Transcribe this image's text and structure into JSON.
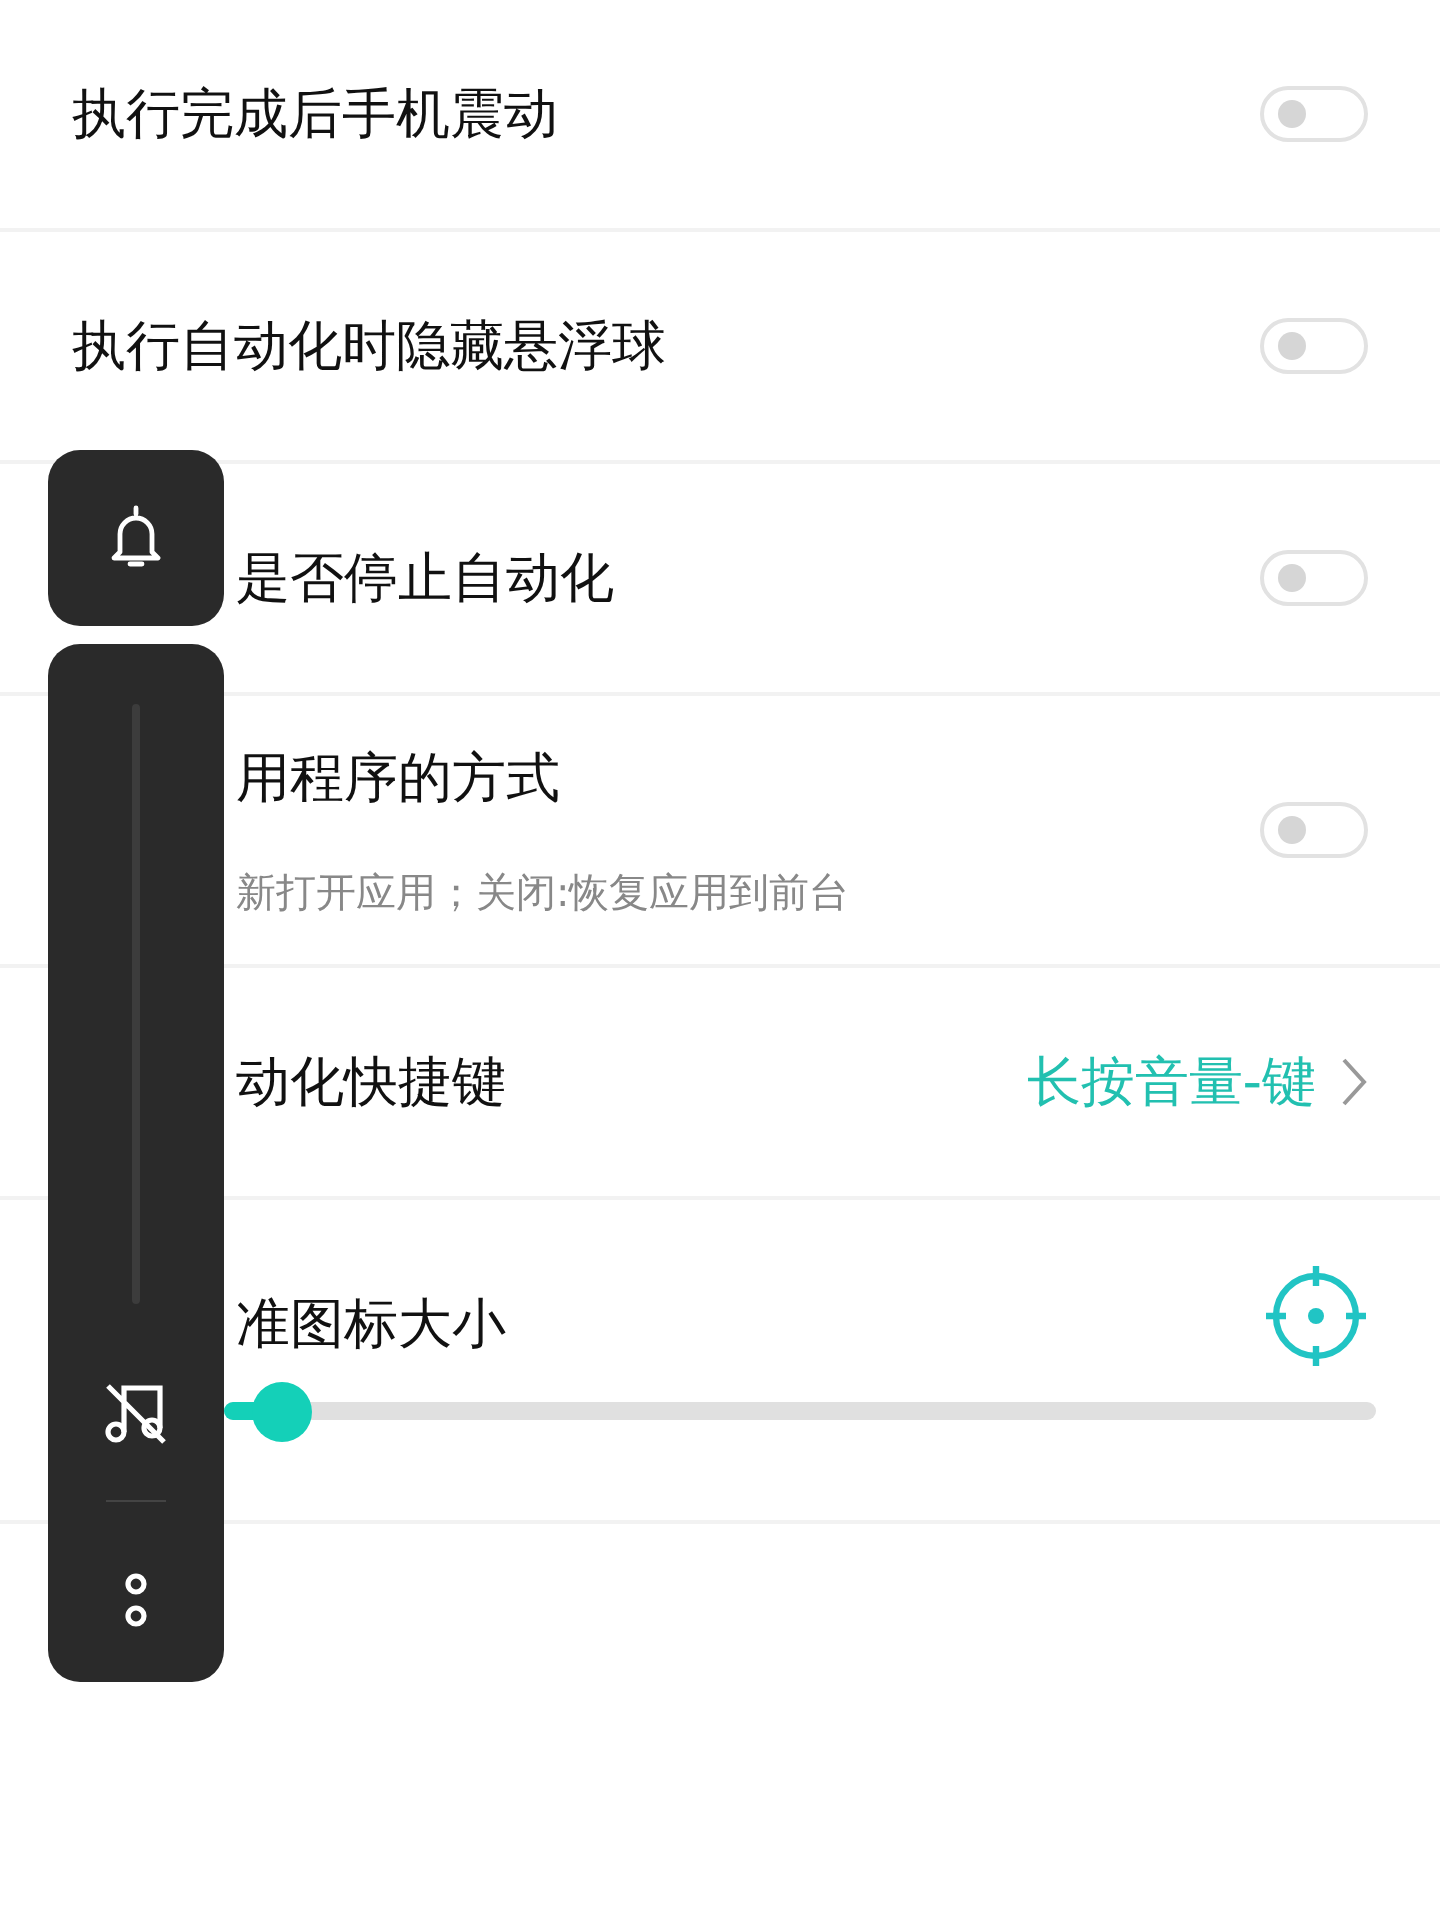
{
  "settings": [
    {
      "kind": "toggle",
      "label": "执行完成后手机震动",
      "on": false
    },
    {
      "kind": "toggle",
      "label": "执行自动化时隐藏悬浮球",
      "on": false
    },
    {
      "kind": "toggle",
      "label": "是否停止自动化",
      "partly_hidden": true,
      "on": false
    },
    {
      "kind": "toggle",
      "label": "用程序的方式",
      "subtitle": "新打开应用；关闭:恢复应用到前台",
      "partly_hidden": true,
      "on": false
    },
    {
      "kind": "link",
      "label": "动化快捷键",
      "partly_hidden": true,
      "value": "长按音量-键"
    },
    {
      "kind": "slider",
      "label": "准图标大小",
      "partly_hidden": true,
      "level": 0.05
    }
  ]
}
